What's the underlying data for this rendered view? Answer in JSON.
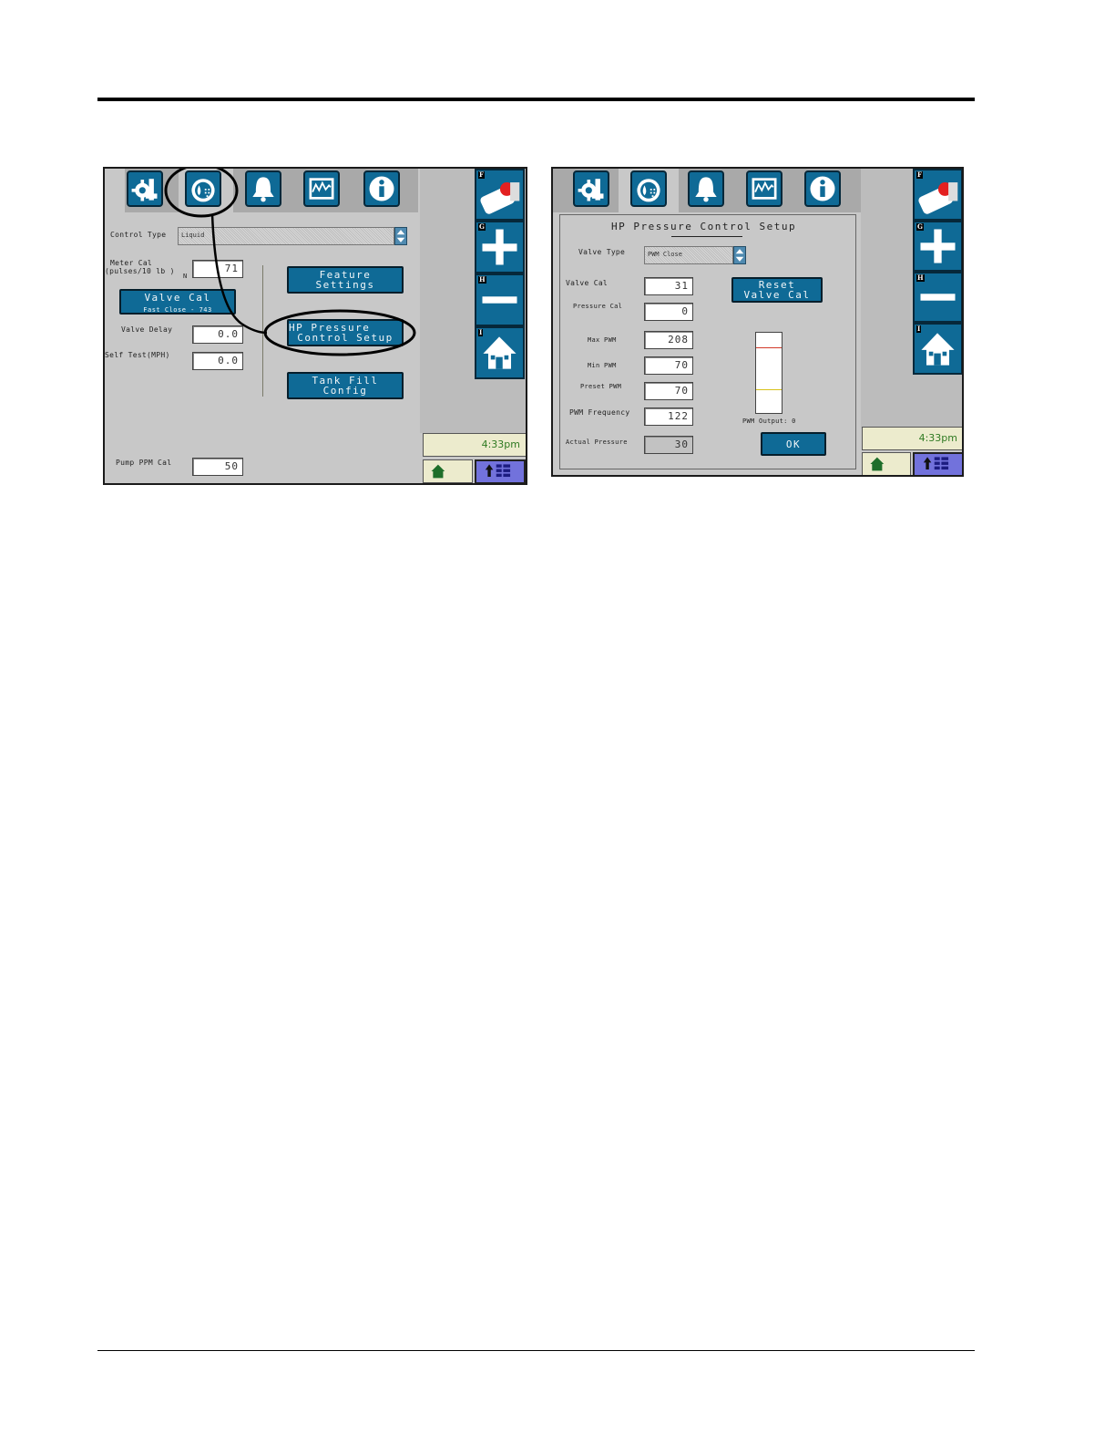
{
  "left_screen": {
    "tabs": [
      "gear-wrench-icon",
      "gear-droplet-icon",
      "bell-icon",
      "graph-icon",
      "info-icon"
    ],
    "control_type": {
      "label": "Control Type",
      "value": "Liquid"
    },
    "meter_cal": {
      "label_line1": "Meter Cal",
      "label_line2": "(pulses/10  lb )",
      "suffix": "N",
      "value": "71"
    },
    "valve_cal_button": {
      "label": "Valve Cal",
      "sub": "Fast Close   - 743"
    },
    "valve_delay": {
      "label": "Valve Delay",
      "value": "0.0"
    },
    "self_test": {
      "label": "Self Test(MPH)",
      "value": "0.0"
    },
    "feature_settings": {
      "line1": "Feature",
      "line2": "Settings"
    },
    "hp_pressure": {
      "line1": "HP Pressure",
      "line2": "Control Setup"
    },
    "tank_fill": {
      "line1": "Tank Fill",
      "line2": "Config"
    },
    "pump_ppm": {
      "label": "Pump PPM Cal",
      "value": "50"
    },
    "side_keys": [
      "F",
      "G",
      "H",
      "I"
    ],
    "clock": "4:33pm"
  },
  "right_screen": {
    "tabs": [
      "gear-wrench-icon",
      "gear-droplet-icon",
      "bell-icon",
      "graph-icon",
      "info-icon"
    ],
    "title": "HP Pressure  Control Setup",
    "valve_type": {
      "label": "Valve Type",
      "value": "PWM Close"
    },
    "valve_cal": {
      "label": "Valve Cal",
      "value": "31"
    },
    "pressure_cal": {
      "label": "Pressure Cal",
      "value": "0"
    },
    "max_pwm": {
      "label": "Max PWM",
      "value": "208"
    },
    "min_pwm": {
      "label": "Min PWM",
      "value": "70"
    },
    "preset_pwm": {
      "label": "Preset PWM",
      "value": "70"
    },
    "pwm_frequency": {
      "label": "PWM Frequency",
      "value": "122"
    },
    "actual_pressure": {
      "label": "Actual Pressure",
      "value": "30"
    },
    "reset_button": {
      "line1": "Reset",
      "line2": "Valve Cal"
    },
    "pwm_output": {
      "label": "PWM Output: 0",
      "value": 0
    },
    "ok_label": "OK",
    "side_keys": [
      "F",
      "G",
      "H",
      "I"
    ],
    "clock": "4:33pm"
  },
  "colors": {
    "button": "#0f6a96",
    "screen_bg": "#c8c8c8",
    "clock_text": "#2f7a22",
    "menu_button": "#7272dc"
  }
}
